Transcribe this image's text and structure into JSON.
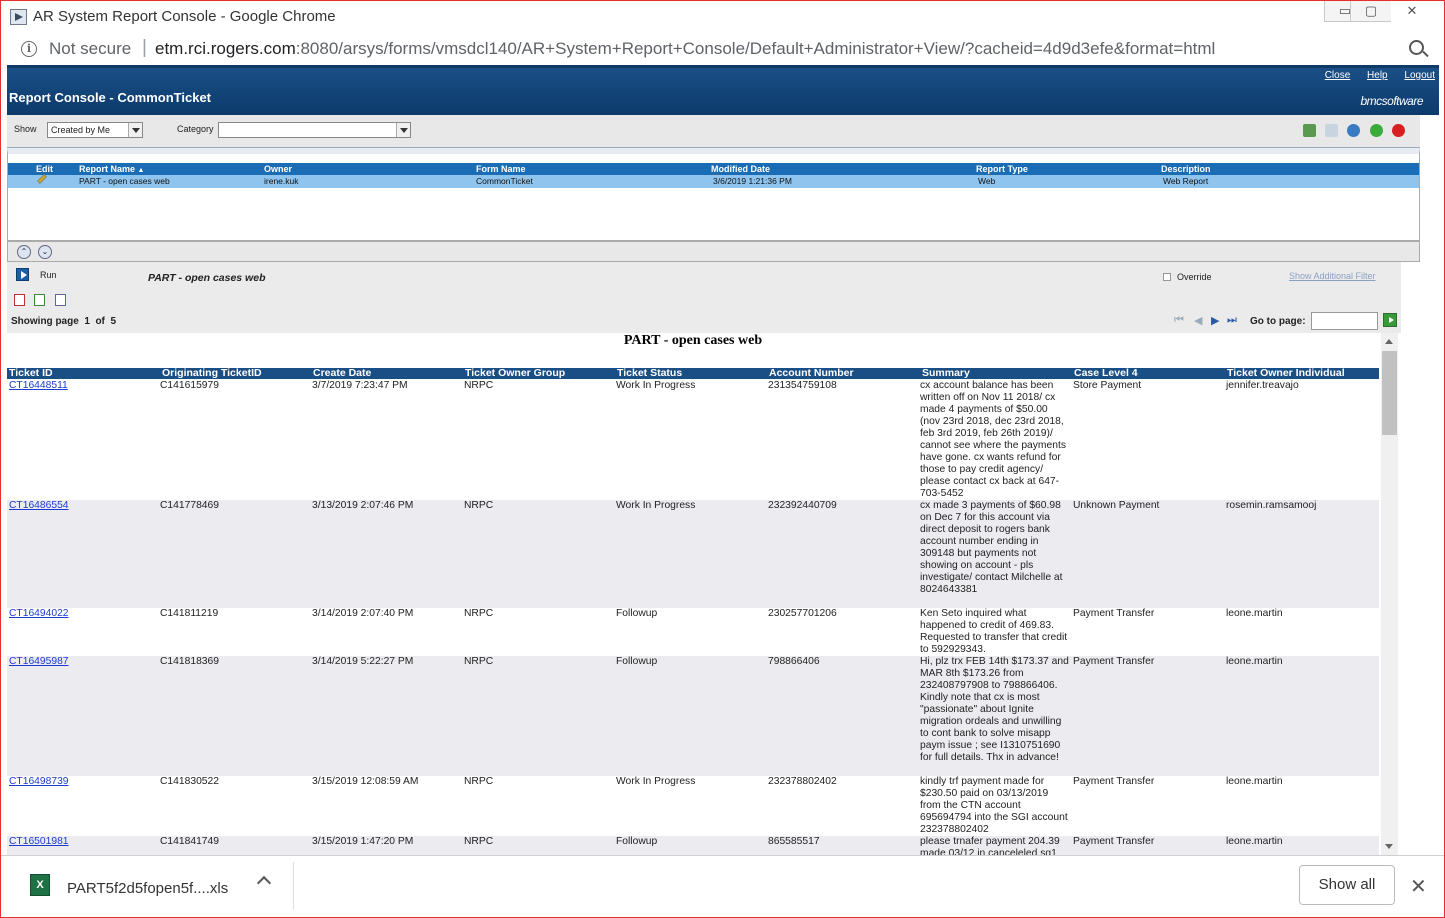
{
  "window": {
    "title": "AR System Report Console - Google Chrome",
    "min": "▭",
    "max": "▢",
    "close": "✕"
  },
  "address": {
    "security": "Not secure",
    "host": "etm.rci.rogers.com",
    "path": ":8080/arsys/forms/vmsdcl140/AR+System+Report+Console/Default+Administrator+View/?cacheid=4d9d3efe&format=html"
  },
  "header": {
    "title": "Report Console - CommonTicket",
    "links": [
      "Close",
      "Help",
      "Logout"
    ],
    "logo": "bmcsoftware"
  },
  "filter": {
    "show_label": "Show",
    "show_value": "Created by Me",
    "category_label": "Category",
    "category_value": ""
  },
  "grid": {
    "columns": [
      "Edit",
      "Report Name",
      "Owner",
      "Form Name",
      "Modified Date",
      "Report Type",
      "Description"
    ],
    "sort_indicator": "▲",
    "row": {
      "name": "PART - open cases web",
      "owner": "irene.kuk",
      "form": "CommonTicket",
      "modified": "3/6/2019 1:21:36 PM",
      "type": "Web",
      "description": "Web Report"
    }
  },
  "run": {
    "label": "Run",
    "report_name": "PART - open cases web",
    "override": "Override",
    "filter_link": "Show Additional Filter"
  },
  "pager": {
    "text": "Showing page  1  of  5",
    "goto": "Go to page:",
    "first": "⏮",
    "prev": "◀",
    "next": "▶",
    "last": "⏭"
  },
  "report": {
    "title": "PART - open cases web",
    "columns": [
      "Ticket ID",
      "Originating TicketID",
      "Create Date",
      "Ticket Owner Group",
      "Ticket Status",
      "Account Number",
      "Summary",
      "Case Level 4",
      "Ticket Owner Individual"
    ],
    "rows": [
      {
        "id": "CT16448511",
        "orig": "C141615979",
        "date": "3/7/2019 7:23:47 PM",
        "group": "NRPC",
        "status": "Work In Progress",
        "account": "231354759108",
        "summary": "cx account balance has been written off on Nov 11 2018/ cx made 4 payments of $50.00 (nov 23rd 2018, dec 23rd 2018, feb 3rd 2019, feb 26th 2019)/ cannot see where the payments have gone. cx wants refund for those to pay credit agency/ please contact cx back at 647-703-5452",
        "level": "Store Payment",
        "owner": "jennifer.treavajo"
      },
      {
        "id": "CT16486554",
        "orig": "C141778469",
        "date": "3/13/2019 2:07:46 PM",
        "group": "NRPC",
        "status": "Work In Progress",
        "account": "232392440709",
        "summary": "cx made 3 payments of $60.98 on Dec 7 for this account via direct deposit to rogers bank account number ending in 309148 but payments not showing on account - pls investigate/ contact Milchelle at 8024643381",
        "level": "Unknown Payment",
        "owner": "rosemin.ramsamooj"
      },
      {
        "id": "CT16494022",
        "orig": "C141811219",
        "date": "3/14/2019 2:07:40 PM",
        "group": "NRPC",
        "status": "Followup",
        "account": "230257701206",
        "summary": "Ken Seto inquired what happened to credit of 469.83. Requested to transfer that credit to 592929343.",
        "level": "Payment Transfer",
        "owner": "leone.martin"
      },
      {
        "id": "CT16495987",
        "orig": "C141818369",
        "date": "3/14/2019 5:22:27 PM",
        "group": "NRPC",
        "status": "Followup",
        "account": "798866406",
        "summary": "Hi, plz trx FEB 14th $173.37 and MAR 8th $173.26 from 232408797908 to 798866406. Kindly note that cx is most \"passionate\" about Ignite migration ordeals and unwilling to cont bank to solve misapp paym issue ; see I1310751690 for full details. Thx in advance!",
        "level": "Payment Transfer",
        "owner": "leone.martin"
      },
      {
        "id": "CT16498739",
        "orig": "C141830522",
        "date": "3/15/2019 12:08:59 AM",
        "group": "NRPC",
        "status": "Work In Progress",
        "account": "232378802402",
        "summary": "kindly trf payment made for $230.50 paid on 03/13/2019 from the CTN account 695694794 into the SGI account  232378802402",
        "level": "Payment Transfer",
        "owner": "leone.martin"
      },
      {
        "id": "CT16501981",
        "orig": "C141841749",
        "date": "3/15/2019 1:47:20 PM",
        "group": "NRPC",
        "status": "Followup",
        "account": "865585517",
        "summary": "please trnafer payment 204.39 made 03/12 in canceleled sg1",
        "level": "Payment Transfer",
        "owner": "leone.martin"
      }
    ]
  },
  "download": {
    "filename": "PART5f2d5fopen5f....xls",
    "show_all": "Show all",
    "close": "✕",
    "file_icon": "X"
  }
}
